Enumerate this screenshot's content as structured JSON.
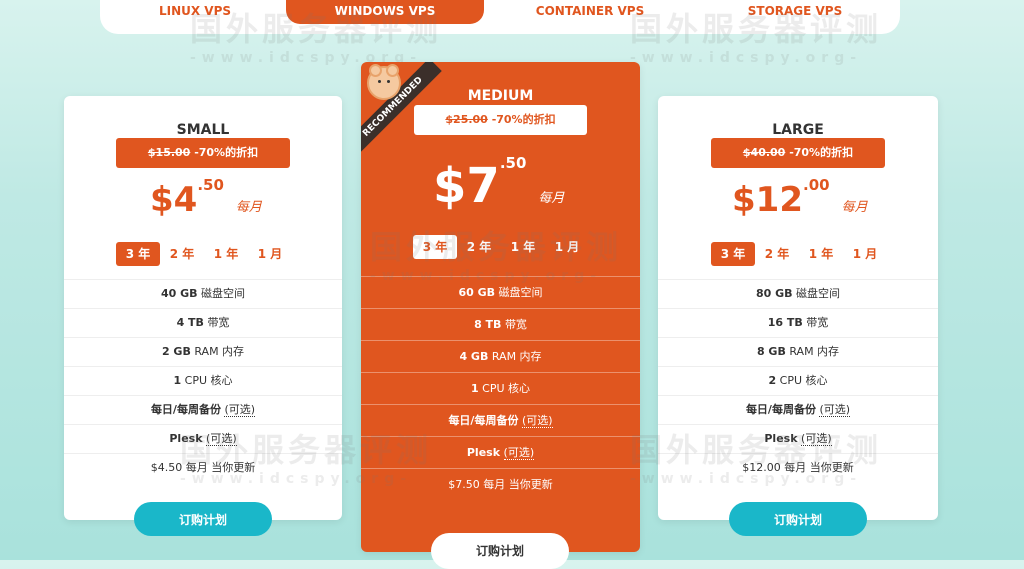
{
  "nav": {
    "tabs": [
      {
        "label": "LINUX VPS",
        "active": false
      },
      {
        "label": "WINDOWS VPS",
        "active": true
      },
      {
        "label": "CONTAINER VPS",
        "active": false
      },
      {
        "label": "STORAGE VPS",
        "active": false
      }
    ]
  },
  "watermark": {
    "text": "国外服务器评测",
    "sub": "-www.idcspy.org-"
  },
  "plans": {
    "small": {
      "name": "SMALL",
      "old_price": "$15.00",
      "discount": "-70%的折扣",
      "currency": "$",
      "price_int": "4",
      "price_cents": ".50",
      "period": "每月",
      "terms": [
        "3 年",
        "2 年",
        "1 年",
        "1 月"
      ],
      "features": [
        "40 GB",
        "磁盘空间",
        "4 TB",
        "带宽",
        "2 GB",
        "RAM 内存",
        "1",
        "CPU 核心",
        "每日/每周备份",
        "(可选)",
        "Plesk",
        "(可选)",
        "$4.50 每月 当你更新"
      ],
      "button": "订购计划"
    },
    "medium": {
      "name": "MEDIUM",
      "badge": "RECOMMENDED",
      "old_price": "$25.00",
      "discount": "-70%的折扣",
      "currency": "$",
      "price_int": "7",
      "price_cents": ".50",
      "period": "每月",
      "terms": [
        "3 年",
        "2 年",
        "1 年",
        "1 月"
      ],
      "features": [
        "60 GB",
        "磁盘空间",
        "8 TB",
        "带宽",
        "4 GB",
        "RAM 内存",
        "1",
        "CPU 核心",
        "每日/每周备份",
        "(可选)",
        "Plesk",
        "(可选)",
        "$7.50 每月 当你更新"
      ],
      "button": "订购计划"
    },
    "large": {
      "name": "LARGE",
      "old_price": "$40.00",
      "discount": "-70%的折扣",
      "currency": "$",
      "price_int": "12",
      "price_cents": ".00",
      "period": "每月",
      "terms": [
        "3 年",
        "2 年",
        "1 年",
        "1 月"
      ],
      "features": [
        "80 GB",
        "磁盘空间",
        "16 TB",
        "带宽",
        "8 GB",
        "RAM 内存",
        "2",
        "CPU 核心",
        "每日/每周备份",
        "(可选)",
        "Plesk",
        "(可选)",
        "$12.00 每月 当你更新"
      ],
      "button": "订购计划"
    }
  },
  "colors": {
    "accent": "#e0561f",
    "button": "#1ab7c9",
    "badge": "#3b2f2a"
  }
}
